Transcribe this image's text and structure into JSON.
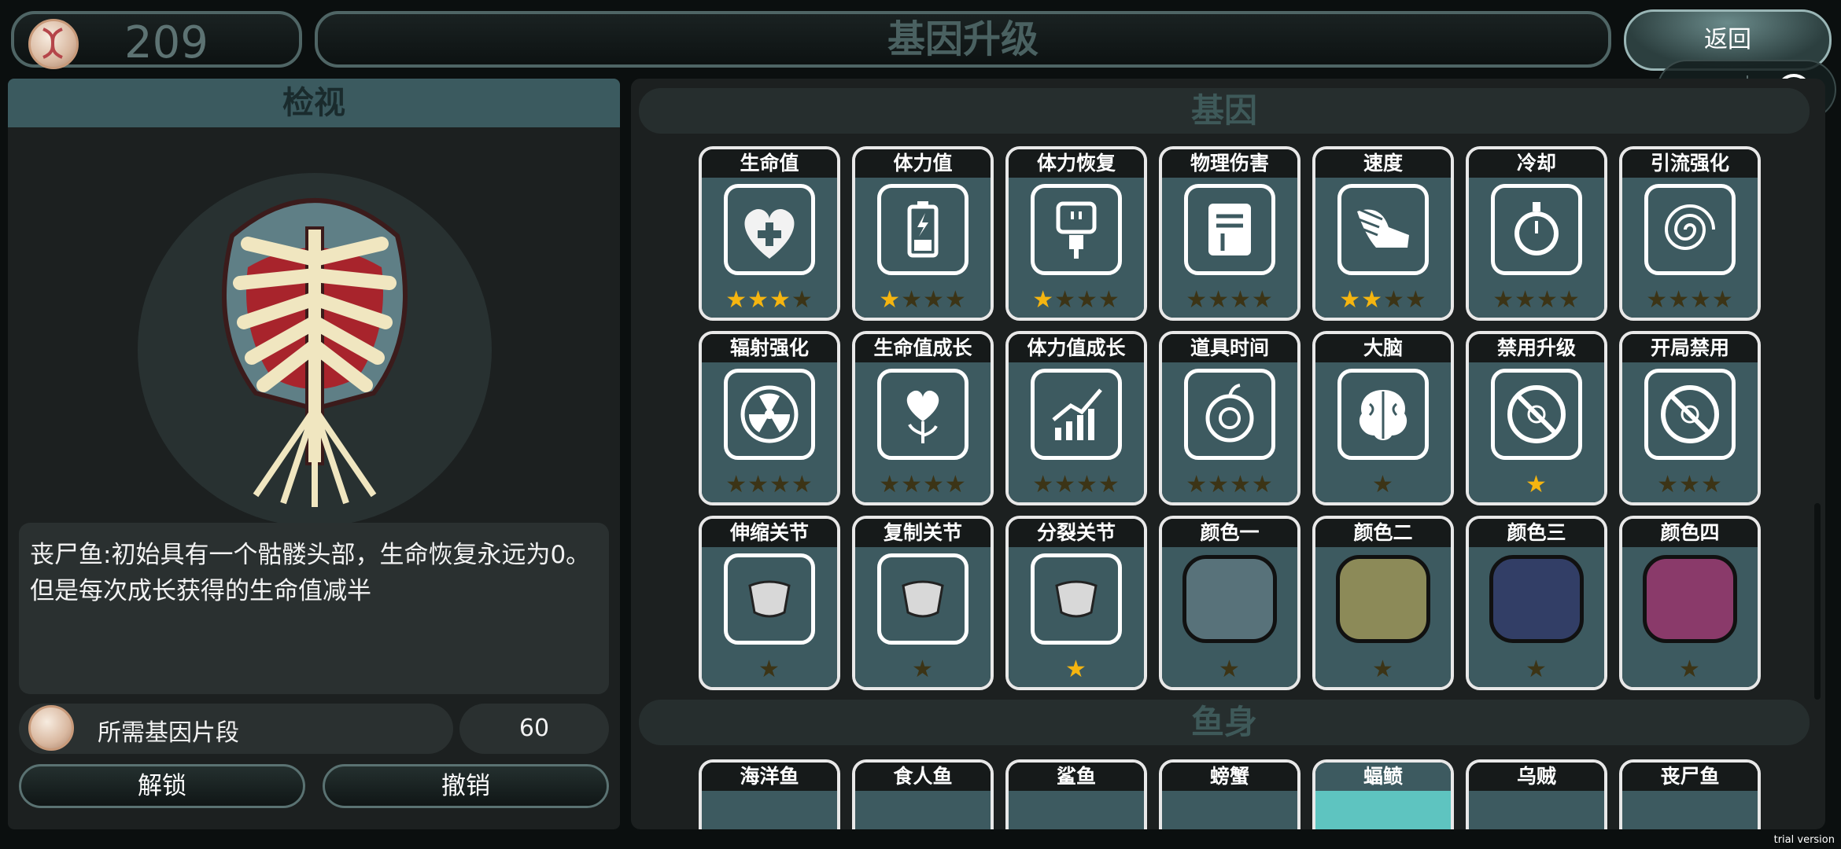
{
  "topbar": {
    "coins": "209",
    "title": "基因升级",
    "back_label": "返回"
  },
  "inspect": {
    "header": "检视",
    "description_line1": "丧尸鱼:初始具有一个骷髅头部，生命恢复永远为0。",
    "description_line2": "但是每次成长获得的生命值减半",
    "required_label": "所需基因片段",
    "required_count": "60",
    "unlock_label": "解锁",
    "cancel_label": "撤销"
  },
  "genes": {
    "header": "基因",
    "cards": [
      {
        "title": "生命值",
        "icon": "heart-plus-icon",
        "stars": 3,
        "max": 4
      },
      {
        "title": "体力值",
        "icon": "battery-icon",
        "stars": 1,
        "max": 4
      },
      {
        "title": "体力恢复",
        "icon": "plug-icon",
        "stars": 1,
        "max": 4
      },
      {
        "title": "物理伤害",
        "icon": "fist-icon",
        "stars": 0,
        "max": 4
      },
      {
        "title": "速度",
        "icon": "winged-shoe-icon",
        "stars": 2,
        "max": 4
      },
      {
        "title": "冷却",
        "icon": "stopwatch-icon",
        "stars": 0,
        "max": 4
      },
      {
        "title": "引流强化",
        "icon": "vortex-icon",
        "stars": 0,
        "max": 4
      },
      {
        "title": "辐射强化",
        "icon": "radiation-icon",
        "stars": 0,
        "max": 4
      },
      {
        "title": "生命值成长",
        "icon": "growing-heart-icon",
        "stars": 0,
        "max": 4
      },
      {
        "title": "体力值成长",
        "icon": "growth-chart-icon",
        "stars": 0,
        "max": 4
      },
      {
        "title": "道具时间",
        "icon": "apple-clock-icon",
        "stars": 0,
        "max": 4
      },
      {
        "title": "大脑",
        "icon": "brain-icon",
        "stars": 0,
        "max": 1
      },
      {
        "title": "禁用升级",
        "icon": "no-biohazard-icon",
        "stars": 1,
        "max": 1
      },
      {
        "title": "开局禁用",
        "icon": "no-biohazard-icon",
        "stars": 0,
        "max": 3
      },
      {
        "title": "伸缩关节",
        "icon": "joint-icon",
        "stars": 0,
        "max": 1
      },
      {
        "title": "复制关节",
        "icon": "joint-icon",
        "stars": 0,
        "max": 1
      },
      {
        "title": "分裂关节",
        "icon": "joint-icon",
        "stars": 1,
        "max": 1
      },
      {
        "title": "颜色一",
        "swatch": "#58727a",
        "stars": 0,
        "max": 1
      },
      {
        "title": "颜色二",
        "swatch": "#8c8a58",
        "stars": 0,
        "max": 1
      },
      {
        "title": "颜色三",
        "swatch": "#323e66",
        "stars": 0,
        "max": 1
      },
      {
        "title": "颜色四",
        "swatch": "#8a3a6a",
        "stars": 0,
        "max": 1
      }
    ]
  },
  "fish_body": {
    "header": "鱼身",
    "cards": [
      {
        "title": "海洋鱼"
      },
      {
        "title": "食人鱼"
      },
      {
        "title": "鲨鱼"
      },
      {
        "title": "螃蟹"
      },
      {
        "title": "蝠鲼",
        "selected": true
      },
      {
        "title": "乌贼"
      },
      {
        "title": "丧尸鱼"
      }
    ]
  },
  "watermark": "trial version"
}
